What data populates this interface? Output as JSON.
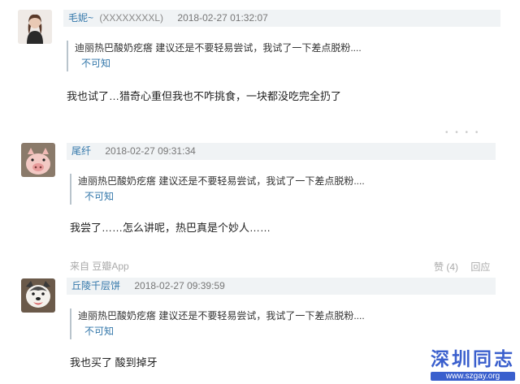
{
  "comments": [
    {
      "author": "毛妮~",
      "uid": "(XXXXXXXXL)",
      "time": "2018-02-27 01:32:07",
      "quote_text": "迪丽热巴酸奶疙瘩 建议还是不要轻易尝试，我试了一下差点脱粉....",
      "quote_author": "不可知",
      "body": "我也试了…猎奇心重但我也不咋挑食，一块都没吃完全扔了"
    },
    {
      "author": "尾纤",
      "time": "2018-02-27 09:31:34",
      "quote_text": "迪丽热巴酸奶疙瘩 建议还是不要轻易尝试，我试了一下差点脱粉....",
      "quote_author": "不可知",
      "body": "我尝了……怎么讲呢，热巴真是个妙人……",
      "source": "来自 豆瓣App",
      "actions": {
        "like": "赞 (4)",
        "reply": "回应"
      }
    },
    {
      "author": "丘陵千层饼",
      "time": "2018-02-27 09:39:59",
      "quote_text": "迪丽热巴酸奶疙瘩 建议还是不要轻易尝试，我试了一下差点脱粉....",
      "quote_author": "不可知",
      "body": "我也买了 酸到掉牙"
    }
  ],
  "watermark": {
    "title": "深圳同志",
    "url": "www.szgay.org"
  },
  "colors": {
    "accent": "#3377aa",
    "meta_bg": "#f0f3f5",
    "watermark": "#3a5fcd"
  }
}
